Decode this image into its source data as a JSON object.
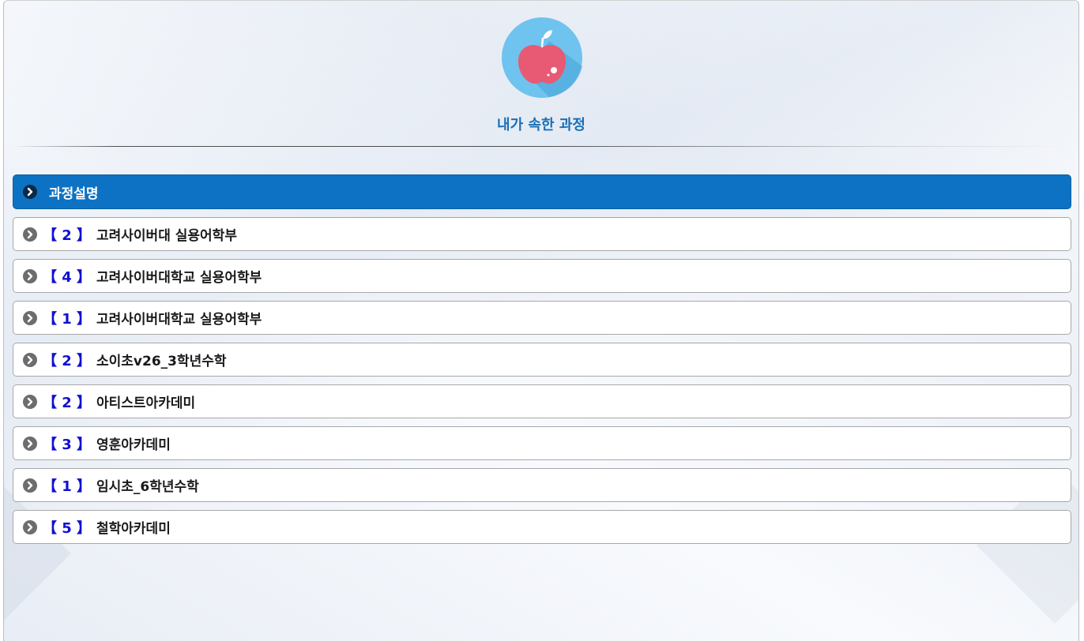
{
  "header": {
    "title": "내가 속한 과정",
    "logo_icon": "apple-icon"
  },
  "list": {
    "header_label": "과정설명",
    "items": [
      {
        "count": "【 2 】",
        "name": "고려사이버대 실용어학부"
      },
      {
        "count": "【 4 】",
        "name": "고려사이버대학교 실용어학부"
      },
      {
        "count": "【 1 】",
        "name": "고려사이버대학교 실용어학부"
      },
      {
        "count": "【 2 】",
        "name": "소이초v26_3학년수학"
      },
      {
        "count": "【 2 】",
        "name": "아티스트아카데미"
      },
      {
        "count": "【 3 】",
        "name": "영훈아카데미"
      },
      {
        "count": "【 1 】",
        "name": "임시초_6학년수학"
      },
      {
        "count": "【 5 】",
        "name": "철학아카데미"
      }
    ]
  },
  "colors": {
    "accent": "#0d72c3",
    "title": "#1a6fb8",
    "count": "#1010d0"
  }
}
